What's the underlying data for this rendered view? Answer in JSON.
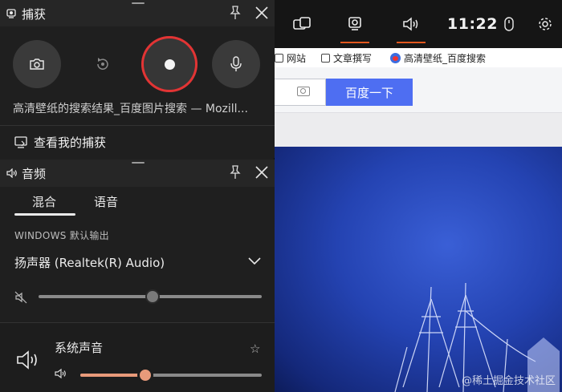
{
  "browser": {
    "bookmarks": [
      "网站",
      "文章撰写",
      "高清壁纸_百度搜索"
    ],
    "search_button": "百度一下",
    "watermark": "@稀土掘金技术社区"
  },
  "gamebar": {
    "time": "11:22",
    "icons": [
      "widget-menu-icon",
      "capture-icon",
      "audio-icon",
      "mouse-icon",
      "settings-icon"
    ]
  },
  "capture": {
    "title": "捕获",
    "caption": "高清壁纸的搜索结果_百度图片搜索 — Mozill...",
    "view_captures": "查看我的捕获",
    "buttons": [
      "screenshot-button",
      "record-last-button",
      "record-button",
      "mic-button"
    ]
  },
  "audio": {
    "title": "音频",
    "tabs": [
      "混合",
      "语音"
    ],
    "active_tab": "混合",
    "output_label": "WINDOWS 默认输出",
    "device": "扬声器 (Realtek(R) Audio)",
    "master_volume_percent": 51,
    "apps": [
      {
        "name": "系统声音",
        "volume_percent": 36
      }
    ]
  },
  "colors": {
    "accent": "#e2571e",
    "record_ring": "#e23434",
    "baidu_blue": "#4e6ef2",
    "slider_active": "#e89a7a"
  }
}
